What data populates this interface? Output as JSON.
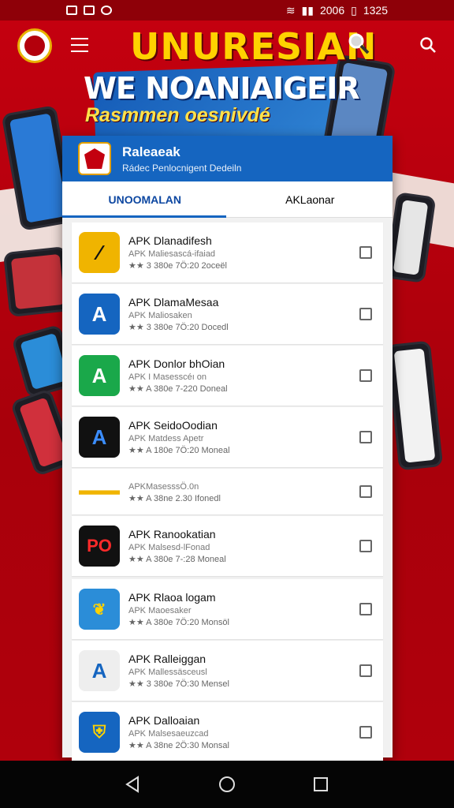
{
  "status_bar": {
    "network": "2006",
    "time": "1325"
  },
  "header": {
    "app_title": "UNURESIAN",
    "headline": "WE NOANIAIGEIR",
    "tagline": "Rasmmen oesnivdé"
  },
  "card": {
    "title": "Raleaeak",
    "subtitle": "Rádec Penlocnigent Dedeiln"
  },
  "tabs": [
    {
      "label": "UNOOMALAN",
      "active": true
    },
    {
      "label": "AKLaonar",
      "active": false
    }
  ],
  "colors": {
    "brand_red": "#b3000c",
    "accent_blue": "#1565c0",
    "star": "#f0a000"
  },
  "apps": [
    {
      "name": "APK Dlanadifesh",
      "developer": "APK Maliesascá-ifaiad",
      "rating": "★★ 3 380e 7Ö:20 2oceël",
      "icon": "yellow-black-logo-icon",
      "checked": false
    },
    {
      "name": "APK DlamaMesaa",
      "developer": "APK Maliosaken",
      "rating": "★★ 3 380e 7Ö:20 Docedl",
      "icon": "blue-a-logo-icon",
      "checked": false
    },
    {
      "name": "APK Donlor bhOian",
      "developer": "APK I Masesscéı on",
      "rating": "★★ A 380e 7-220 Doneal",
      "icon": "green-a-logo-icon",
      "checked": false
    },
    {
      "name": "APK SeidoOodian",
      "developer": "APK Matdess Apetr",
      "rating": "★★ A 180e 7Ö:20 Moneal",
      "icon": "black-a-logo-icon",
      "checked": false
    },
    {
      "name": "",
      "developer": "APKMasesssÖ.0n",
      "rating": "★★ A 38ne 2.30 Ifonedl",
      "icon": "partial-logo-icon",
      "checked": false
    },
    {
      "name": "APK Ranookatian",
      "developer": "APK Malsesd-lFonad",
      "rating": "★★ A 380e 7-:28 Moneal",
      "icon": "po-logo-icon",
      "checked": false
    },
    {
      "name": "APK Rlaoa logam",
      "developer": "APK Maoesaker",
      "rating": "★★ A 380e 7Ö:20 Monsöl",
      "icon": "crest-logo-icon",
      "checked": false
    },
    {
      "name": "APK Ralleiggan",
      "developer": "APK Mallessäsceusl",
      "rating": "★★ 3 380e 7Ö:30 Mensel",
      "icon": "red-blue-a-logo-icon",
      "checked": false
    },
    {
      "name": "APK Dalloaian",
      "developer": "APK Malsesaeuzcad",
      "rating": "★★ A 38ne 2Ö:30 Monsal",
      "icon": "shield-logo-icon",
      "checked": false
    }
  ]
}
